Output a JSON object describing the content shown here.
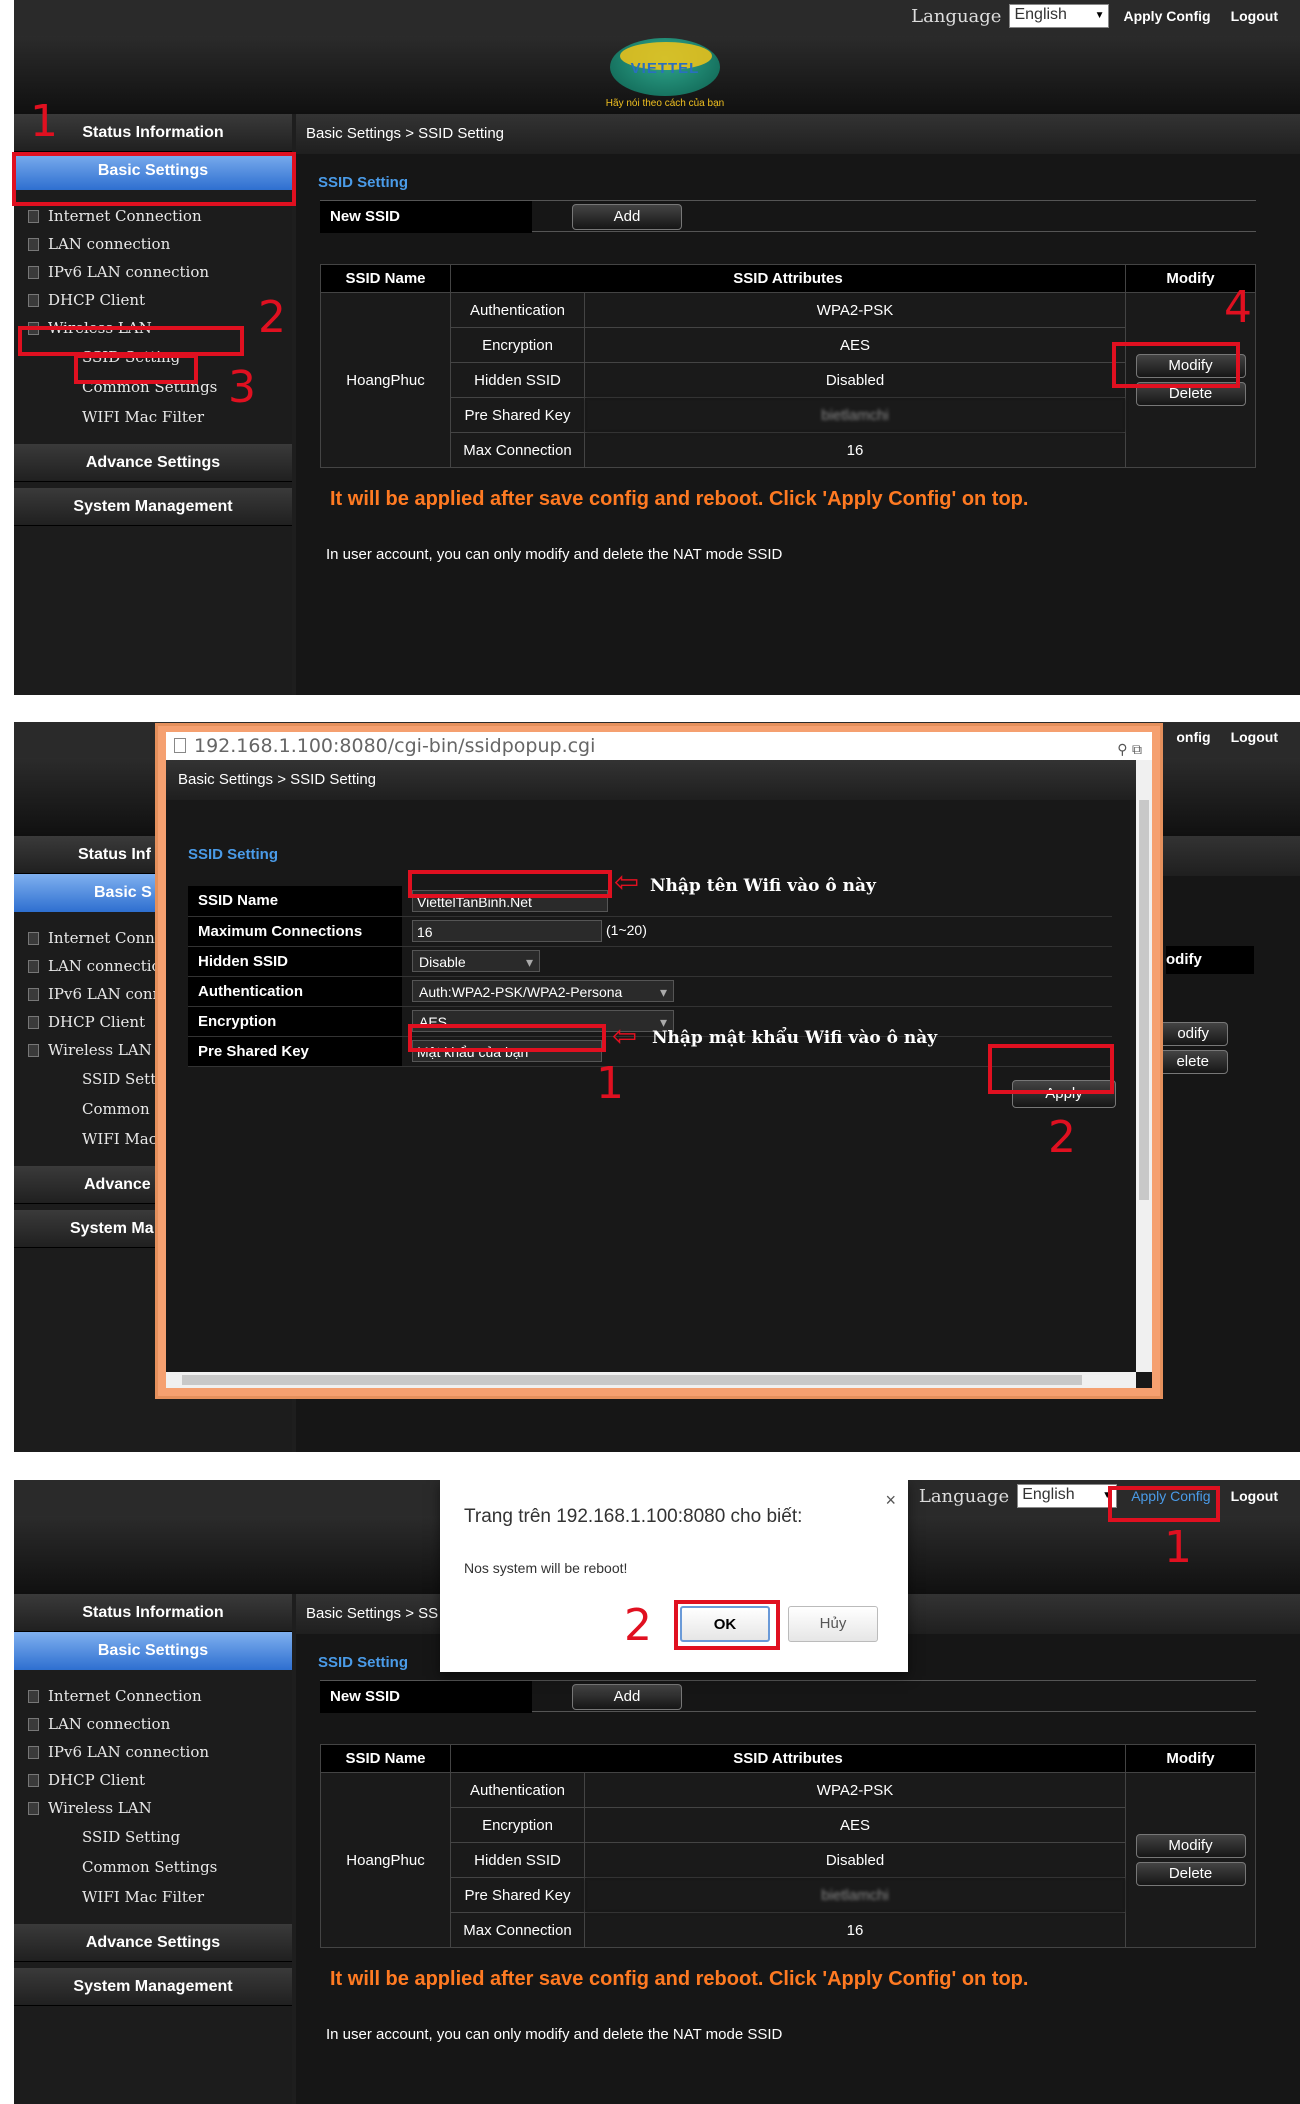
{
  "header": {
    "language_label": "Language",
    "language_value": "English",
    "apply_config": "Apply Config",
    "logout": "Logout",
    "logo_text": "VIETTEL",
    "logo_slogan": "Hãy nói theo cách của bạn"
  },
  "sidebar": {
    "status": "Status Information",
    "basic": "Basic Settings",
    "items": [
      "Internet Connection",
      "LAN connection",
      "IPv6 LAN connection",
      "DHCP Client",
      "Wireless LAN"
    ],
    "wlan_sub": [
      "SSID Setting",
      "Common Settings",
      "WIFI Mac Filter"
    ],
    "advance": "Advance Settings",
    "system": "System Management"
  },
  "main": {
    "breadcrumb": "Basic Settings > SSID Setting",
    "section_title": "SSID Setting",
    "new_ssid_label": "New SSID",
    "add_button": "Add",
    "table": {
      "headers": [
        "SSID Name",
        "SSID Attributes",
        "Modify"
      ],
      "ssid_name": "HoangPhuc",
      "rows": [
        {
          "attr": "Authentication",
          "value": "WPA2-PSK"
        },
        {
          "attr": "Encryption",
          "value": "AES"
        },
        {
          "attr": "Hidden SSID",
          "value": "Disabled"
        },
        {
          "attr": "Pre Shared Key",
          "value": "bietlamchi"
        },
        {
          "attr": "Max Connection",
          "value": "16"
        }
      ],
      "modify_button": "Modify",
      "delete_button": "Delete"
    },
    "warning": "It will be applied after save config and reboot. Click 'Apply Config' on top.",
    "note": "In user account, you can only modify and delete the NAT mode SSID"
  },
  "panel2": {
    "apply_config_partial": "onfig",
    "logout": "Logout",
    "sidebar_partial": {
      "status": "Status Inf",
      "basic": "Basic S",
      "items": [
        "Internet Conne",
        "LAN connectio",
        "IPv6 LAN conn",
        "DHCP Client",
        "Wireless LAN"
      ],
      "wlan_sub": [
        "SSID Setti",
        "Common S",
        "WIFI Mac"
      ],
      "advance": "Advance",
      "system": "System Ma"
    },
    "bg_partial": {
      "modify_header": "odify",
      "modify_btn": "odify",
      "delete_btn": "elete"
    },
    "popup": {
      "url": "192.168.1.100:8080/cgi-bin/ssidpopup.cgi",
      "breadcrumb": "Basic Settings > SSID Setting",
      "title": "SSID Setting",
      "fields": [
        {
          "label": "SSID Name",
          "value": "ViettelTanBinh.Net"
        },
        {
          "label": "Maximum Connections",
          "value": "16",
          "hint": "(1~20)"
        },
        {
          "label": "Hidden SSID",
          "value": "Disable"
        },
        {
          "label": "Authentication",
          "value": "Auth:WPA2-PSK/WPA2-Persona"
        },
        {
          "label": "Encryption",
          "value": "AES"
        },
        {
          "label": "Pre Shared Key",
          "value": "Mật khẩu của bạn"
        }
      ],
      "apply_button": "Apply",
      "annotation_ssid": "Nhập tên Wifi vào ô này",
      "annotation_key": "Nhập mật khẩu Wifi vào ô này"
    }
  },
  "panel3": {
    "breadcrumb_partial": "Basic Settings > SS",
    "dialog": {
      "title": "Trang trên 192.168.1.100:8080 cho biết:",
      "message": "Nos system will be reboot!",
      "ok": "OK",
      "cancel": "Hủy",
      "close": "×"
    }
  },
  "annotations": {
    "p1": [
      "1",
      "2",
      "3",
      "4"
    ],
    "p2": [
      "1",
      "2"
    ],
    "p3": [
      "1",
      "2"
    ]
  },
  "colors": {
    "annotation": "#e01020",
    "active_tab": "#2e6fd0",
    "warning": "#ff7a22",
    "section_title": "#4a9be8"
  }
}
